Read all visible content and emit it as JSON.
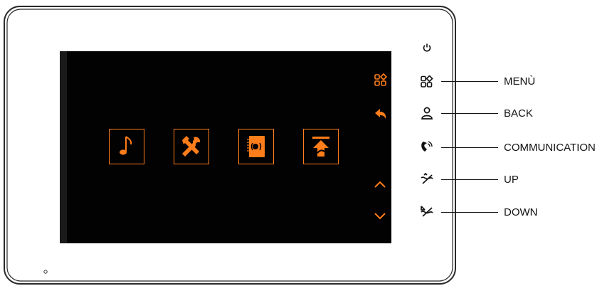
{
  "colors": {
    "accent": "#ff7d1a",
    "frame": "#222222",
    "screen": "#020202",
    "text": "#111111"
  },
  "screen_tiles": [
    {
      "icon": "music-note-icon"
    },
    {
      "icon": "tools-icon"
    },
    {
      "icon": "intercom-monitor-icon"
    },
    {
      "icon": "upload-arrow-icon"
    }
  ],
  "screen_side_icons": [
    "menu-grid-icon",
    "back-arrow-icon",
    "chevron-up-icon",
    "chevron-down-icon"
  ],
  "hard_buttons": [
    {
      "icon": "power-icon"
    },
    {
      "icon": "menu-grid-icon",
      "label": "MENÙ"
    },
    {
      "icon": "person-icon",
      "label": "BACK"
    },
    {
      "icon": "handset-icon",
      "label": "COMMUNICATION"
    },
    {
      "icon": "up-symbol-icon",
      "label": "UP"
    },
    {
      "icon": "down-symbol-icon",
      "label": "DOWN"
    }
  ]
}
